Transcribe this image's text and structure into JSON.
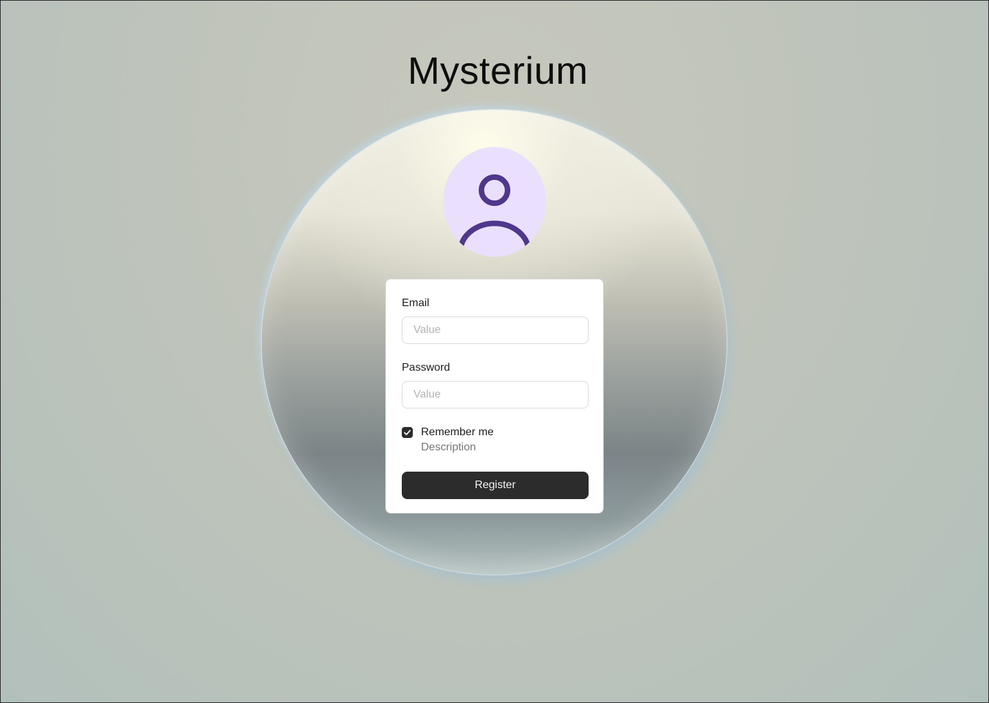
{
  "app": {
    "title": "Mysterium"
  },
  "avatar": {
    "icon": "user-icon",
    "background": "#eae0fd",
    "icon_color": "#4f378a"
  },
  "form": {
    "email": {
      "label": "Email",
      "placeholder": "Value",
      "value": ""
    },
    "password": {
      "label": "Password",
      "placeholder": "Value",
      "value": ""
    },
    "remember": {
      "label": "Remember me",
      "description": "Description",
      "checked": true
    },
    "submit_label": "Register"
  },
  "colors": {
    "button_bg": "#2c2c2c",
    "button_text": "#f5f5f5",
    "card_bg": "#ffffff"
  }
}
